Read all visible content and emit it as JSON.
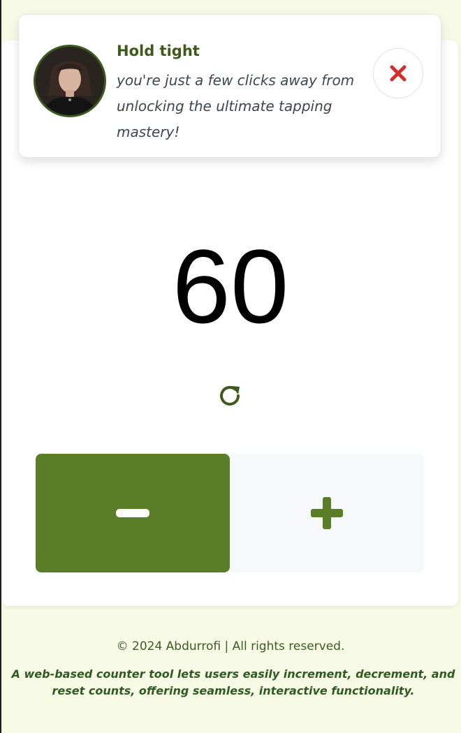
{
  "toast": {
    "title": "Hold tight",
    "message": "you're just a few clicks away from unlocking the ultimate tapping mastery!",
    "close_icon": "close-x-icon",
    "avatar_alt": "user avatar"
  },
  "counter": {
    "value": "60",
    "reset_icon": "refresh-icon"
  },
  "controls": {
    "decrement_icon": "minus-icon",
    "increment_icon": "plus-icon"
  },
  "footer": {
    "copyright": "© 2024 Abdurrofi | All rights reserved.",
    "tagline": "A web-based counter tool lets users easily increment, decrement, and reset counts, offering seamless, interactive functionality."
  },
  "colors": {
    "primary_green": "#5a7d28",
    "dark_green": "#3d5a1a",
    "close_red": "#d32f2f",
    "page_bg": "#f7fbe6"
  }
}
